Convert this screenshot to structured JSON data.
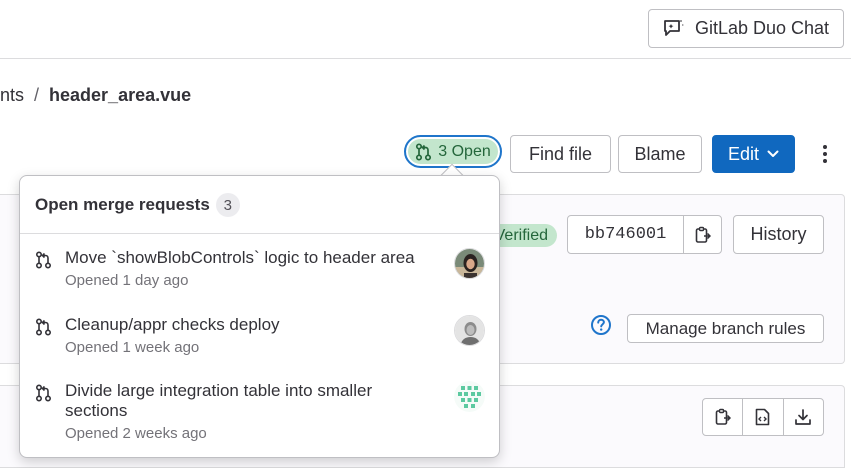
{
  "header": {
    "duo_chat_label": "GitLab Duo Chat"
  },
  "breadcrumb": {
    "parent": "nts",
    "separator": "/",
    "current": "header_area.vue"
  },
  "actions": {
    "open_mr_count_label": "3 Open",
    "find_file_label": "Find file",
    "blame_label": "Blame",
    "edit_label": "Edit"
  },
  "commit": {
    "verified_label": "Verified",
    "sha": "bb746001",
    "history_label": "History",
    "manage_branch_rules_label": "Manage branch rules"
  },
  "merge_requests_popover": {
    "title": "Open merge requests",
    "count": "3",
    "items": [
      {
        "title": "Move `showBlobControls` logic to header area",
        "meta": "Opened 1 day ago"
      },
      {
        "title": "Cleanup/appr checks deploy",
        "meta": "Opened 1 week ago"
      },
      {
        "title": "Divide large integration table into smaller sections",
        "meta": "Opened 2 weeks ago"
      }
    ]
  },
  "colors": {
    "primary": "#1068bf",
    "success_bg": "#c3e6cd",
    "success_text": "#24663b",
    "border": "#bfbfc3"
  },
  "icons": {
    "duo_chat": "duo-chat-icon",
    "merge_request": "merge-request-icon",
    "chevron": "chevron-down-icon",
    "kebab": "ellipsis-v-icon",
    "copy": "copy-icon",
    "help": "question-circle-icon",
    "raw": "document-code-icon",
    "download": "download-icon"
  }
}
